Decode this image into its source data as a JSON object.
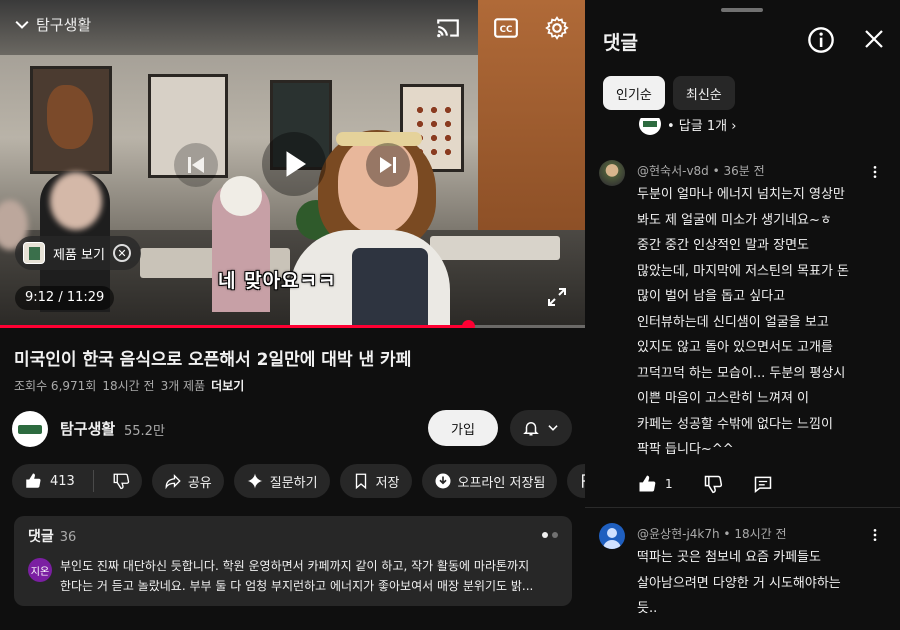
{
  "player": {
    "channel_watermark": "탐구생활",
    "subtitle_caption": "네 맞아요ㅋㅋ",
    "product_chip_label": "제품 보기",
    "time_current": "9:12",
    "time_total": "11:29",
    "time_display": "9:12 / 11:29",
    "progress_fraction": 0.8
  },
  "video": {
    "title": "미국인이 한국 음식으로 오픈해서 2일만에 대박 낸 카페",
    "views": "조회수 6,971회",
    "age": "18시간 전",
    "product_count": "3개 제품",
    "more_label": "더보기"
  },
  "channel": {
    "name": "탐구생활",
    "subscribers": "55.2만",
    "subscribe_label": "가입"
  },
  "actions": {
    "like_count": "413",
    "share": "공유",
    "ask": "질문하기",
    "save": "저장",
    "offline": "오프라인 저장됨",
    "report": "신고"
  },
  "comments_preview": {
    "title": "댓글",
    "count": "36",
    "avatar_text": "지온",
    "line1": "부인도 진짜 대단하신 듯합니다. 학원 운영하면서 카페까지 같이 하고, 작가 활동에 마라톤까지",
    "line2": "한다는 거 듣고 놀랐네요. 부부 둘 다 엄청 부지런하고 에너지가 좋아보여서 매장 분위기도 밝..."
  },
  "panel": {
    "title": "댓글",
    "sort_top": "인기순",
    "sort_new": "최신순",
    "reply_peek": "• 답글 1개 ›"
  },
  "comments": [
    {
      "author": "@현숙서-v8d",
      "age": "36분 전",
      "meta": "@현숙서-v8d • 36분 전",
      "lines": [
        "두분이 얼마나 에너지 넘치는지 영상만",
        "봐도 제 얼굴에 미소가 생기네요~ㅎ",
        "중간 중간 인상적인 말과 장면도",
        "많았는데, 마지막에 저스틴의 목표가 돈",
        "많이 벌어 남을 돕고 싶다고",
        "인터뷰하는데 신디샘이 얼굴을 보고",
        "있지도 않고 돌아 있으면서도 고개를",
        "끄덕끄덕 하는 모습이... 두분의 평상시",
        "이쁜 마음이 고스란히 느껴져 이",
        "카페는 성공할 수밖에 없다는 느낌이",
        "팍팍 듭니다~^^"
      ],
      "like_count": "1"
    },
    {
      "author": "@윤상현-j4k7h",
      "age": "18시간 전",
      "meta": "@윤상현-j4k7h • 18시간 전",
      "lines": [
        "떡파는 곳은 첨보네 요즘 카페들도",
        "살아남으려면 다양한 거 시도해야하는",
        "듯.."
      ]
    }
  ],
  "colors": {
    "background": "#0f0f0f",
    "surface": "#272727",
    "text": "#f1f1f1",
    "secondary_text": "#aaaaaa",
    "progress": "#ff0033"
  },
  "icons": [
    "chevron-down-icon",
    "cast-icon",
    "cc-icon",
    "settings-icon",
    "previous-icon",
    "play-icon",
    "next-icon",
    "close-circle-icon",
    "fullscreen-icon",
    "bell-icon",
    "like-icon",
    "dislike-icon",
    "share-icon",
    "sparkle-icon",
    "bookmark-icon",
    "download-icon",
    "flag-icon",
    "info-icon",
    "close-icon",
    "more-vert-icon",
    "reply-icon"
  ]
}
